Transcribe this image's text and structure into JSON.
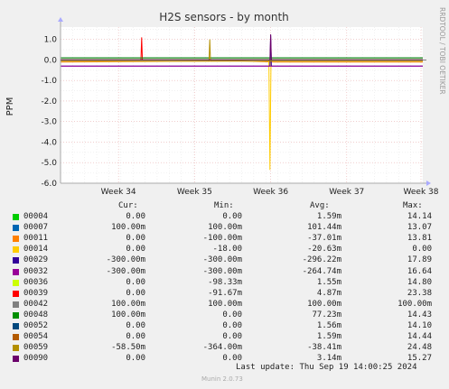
{
  "chart_data": {
    "type": "line",
    "title": "H2S sensors - by month",
    "ylabel": "PPM",
    "side_label": "RRDTOOL / TOBI OETIKER",
    "ylim": [
      -6.0,
      1.6
    ],
    "yticks": [
      "1.0",
      "0.0",
      "-1.0",
      "-2.0",
      "-3.0",
      "-4.0",
      "-5.0",
      "-6.0"
    ],
    "ytick_values": [
      1.0,
      0.0,
      -1.0,
      -2.0,
      -3.0,
      -4.0,
      -5.0,
      -6.0
    ],
    "xlim": [
      0,
      1
    ],
    "xticks": [
      "Week 34",
      "Week 35",
      "Week 36",
      "Week 37",
      "Week 38"
    ],
    "xtick_values": [
      0.16,
      0.37,
      0.58,
      0.79,
      0.995
    ],
    "grid": true,
    "series": [
      {
        "name": "00004",
        "color": "#00cc00",
        "points": [
          [
            0,
            0.0
          ],
          [
            1,
            0.0
          ]
        ]
      },
      {
        "name": "00007",
        "color": "#0066b3",
        "points": [
          [
            0,
            0.1
          ],
          [
            1,
            0.1
          ]
        ]
      },
      {
        "name": "00011",
        "color": "#ff8000",
        "points": [
          [
            0,
            -0.1
          ],
          [
            0.5,
            -0.05
          ],
          [
            0.59,
            -0.1
          ],
          [
            1,
            -0.1
          ]
        ]
      },
      {
        "name": "00014",
        "color": "#ffcc00",
        "points": [
          [
            0,
            0.0
          ],
          [
            0.575,
            0.0
          ],
          [
            0.578,
            -5.35
          ],
          [
            0.581,
            0.0
          ],
          [
            1,
            0.0
          ]
        ]
      },
      {
        "name": "00029",
        "color": "#330099",
        "points": [
          [
            0,
            -0.3
          ],
          [
            0.578,
            -0.3
          ],
          [
            0.58,
            1.2
          ],
          [
            0.582,
            -0.3
          ],
          [
            1,
            -0.3
          ]
        ]
      },
      {
        "name": "00032",
        "color": "#990099",
        "points": [
          [
            0,
            -0.3
          ],
          [
            1,
            -0.3
          ]
        ]
      },
      {
        "name": "00036",
        "color": "#ccff00",
        "points": [
          [
            0,
            0.0
          ],
          [
            1,
            0.0
          ]
        ]
      },
      {
        "name": "00039",
        "color": "#ff0000",
        "points": [
          [
            0,
            0.0
          ],
          [
            0.222,
            0.0
          ],
          [
            0.224,
            1.1
          ],
          [
            0.226,
            0.0
          ],
          [
            1,
            0.0
          ]
        ]
      },
      {
        "name": "00042",
        "color": "#808080",
        "points": [
          [
            0,
            0.1
          ],
          [
            1,
            0.1
          ]
        ]
      },
      {
        "name": "00048",
        "color": "#008f00",
        "points": [
          [
            0,
            0.1
          ],
          [
            1,
            0.1
          ]
        ]
      },
      {
        "name": "00052",
        "color": "#00487d",
        "points": [
          [
            0,
            0.0
          ],
          [
            1,
            0.0
          ]
        ]
      },
      {
        "name": "00054",
        "color": "#b35a00",
        "points": [
          [
            0,
            0.0
          ],
          [
            1,
            0.0
          ]
        ]
      },
      {
        "name": "00059",
        "color": "#b38f00",
        "points": [
          [
            0,
            -0.06
          ],
          [
            0.41,
            -0.06
          ],
          [
            0.412,
            1.0
          ],
          [
            0.414,
            -0.06
          ],
          [
            1,
            -0.06
          ]
        ]
      },
      {
        "name": "00090",
        "color": "#6b006b",
        "points": [
          [
            0,
            0.0
          ],
          [
            0.578,
            0.0
          ],
          [
            0.58,
            1.25
          ],
          [
            0.582,
            0.0
          ],
          [
            1,
            0.0
          ]
        ]
      }
    ]
  },
  "legend": {
    "headers": {
      "cur": "Cur:",
      "min": "Min:",
      "avg": "Avg:",
      "max": "Max:"
    },
    "rows": [
      {
        "name": "00004",
        "color": "#00cc00",
        "cur": "0.00",
        "min": "0.00",
        "avg": "1.59m",
        "max": "14.14"
      },
      {
        "name": "00007",
        "color": "#0066b3",
        "cur": "100.00m",
        "min": "100.00m",
        "avg": "101.44m",
        "max": "13.07"
      },
      {
        "name": "00011",
        "color": "#ff8000",
        "cur": "0.00",
        "min": "-100.00m",
        "avg": "-37.01m",
        "max": "13.81"
      },
      {
        "name": "00014",
        "color": "#ffcc00",
        "cur": "0.00",
        "min": "-18.00",
        "avg": "-20.63m",
        "max": "0.00"
      },
      {
        "name": "00029",
        "color": "#330099",
        "cur": "-300.00m",
        "min": "-300.00m",
        "avg": "-296.22m",
        "max": "17.89"
      },
      {
        "name": "00032",
        "color": "#990099",
        "cur": "-300.00m",
        "min": "-300.00m",
        "avg": "-264.74m",
        "max": "16.64"
      },
      {
        "name": "00036",
        "color": "#ccff00",
        "cur": "0.00",
        "min": "-98.33m",
        "avg": "1.55m",
        "max": "14.80"
      },
      {
        "name": "00039",
        "color": "#ff0000",
        "cur": "0.00",
        "min": "-91.67m",
        "avg": "4.87m",
        "max": "23.38"
      },
      {
        "name": "00042",
        "color": "#808080",
        "cur": "100.00m",
        "min": "100.00m",
        "avg": "100.00m",
        "max": "100.00m"
      },
      {
        "name": "00048",
        "color": "#008f00",
        "cur": "100.00m",
        "min": "0.00",
        "avg": "77.23m",
        "max": "14.43"
      },
      {
        "name": "00052",
        "color": "#00487d",
        "cur": "0.00",
        "min": "0.00",
        "avg": "1.56m",
        "max": "14.10"
      },
      {
        "name": "00054",
        "color": "#b35a00",
        "cur": "0.00",
        "min": "0.00",
        "avg": "1.59m",
        "max": "14.44"
      },
      {
        "name": "00059",
        "color": "#b38f00",
        "cur": "-58.50m",
        "min": "-364.00m",
        "avg": "-38.41m",
        "max": "24.48"
      },
      {
        "name": "00090",
        "color": "#6b006b",
        "cur": "0.00",
        "min": "0.00",
        "avg": "3.14m",
        "max": "15.27"
      }
    ]
  },
  "footer": {
    "last_update": "Last update: Thu Sep 19 14:00:25 2024",
    "munin": "Munin 2.0.73"
  }
}
